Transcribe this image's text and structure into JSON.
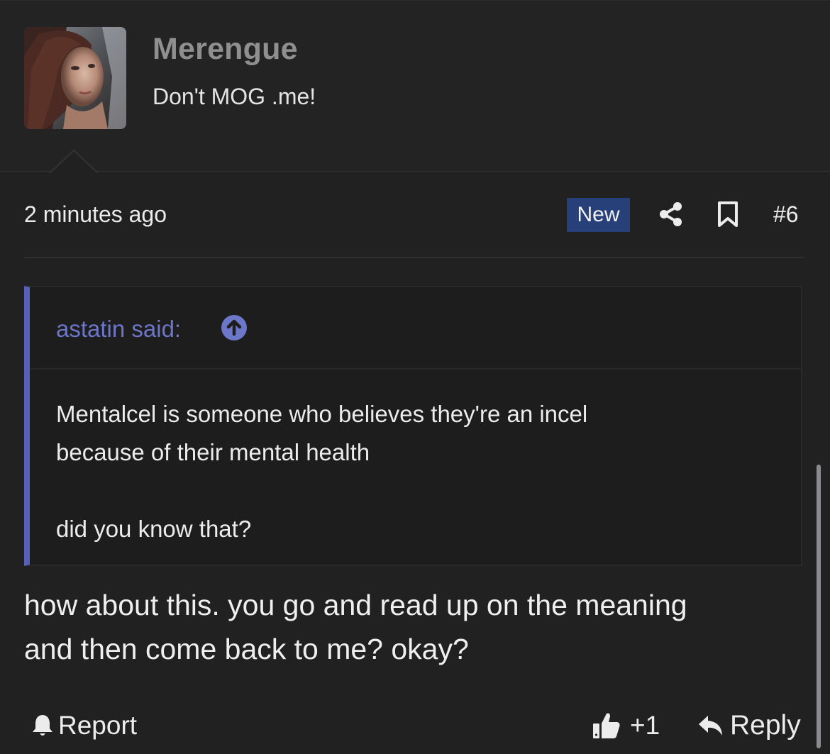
{
  "user": {
    "name": "Merengue",
    "title": "Don't MOG .me!"
  },
  "post_meta": {
    "timestamp": "2 minutes ago",
    "badge": "New",
    "post_number": "#6"
  },
  "quote": {
    "author_label": "astatin said:",
    "lines": [
      "Mentalcel is someone who believes they're an incel",
      "because of their mental health",
      "did you know that?"
    ]
  },
  "message": {
    "lines": [
      "how about this. you go and read up on the meaning",
      "and then come back to me? okay?"
    ]
  },
  "actions": {
    "report": "Report",
    "reaction_count": "+1",
    "reply": "Reply"
  },
  "colors": {
    "accent": "#5761b8",
    "quote_author": "#6d77c9",
    "badge_bg": "#27407a",
    "username": "#8f8f90",
    "background": "#212122"
  },
  "icons": {
    "avatar": "user-avatar-image",
    "share": "share-icon",
    "bookmark": "bookmark-icon",
    "quote_jump": "arrow-up-circle-icon",
    "report": "bell-icon",
    "reaction": "thumbs-up-icon",
    "reply": "reply-arrow-icon"
  }
}
